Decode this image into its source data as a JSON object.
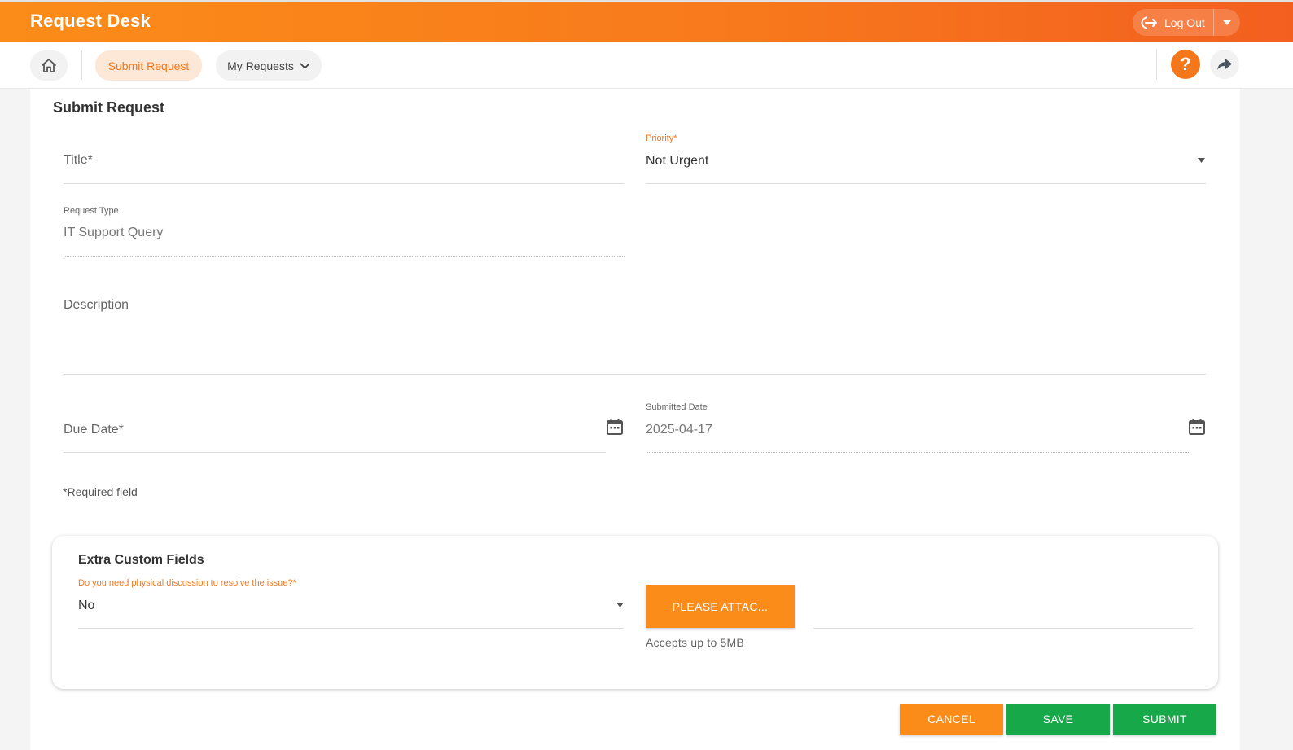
{
  "app": {
    "title": "Request Desk"
  },
  "header": {
    "logout_label": "Log Out"
  },
  "nav": {
    "submit_request": "Submit Request",
    "my_requests": "My Requests",
    "help_glyph": "?"
  },
  "form": {
    "page_title": "Submit Request",
    "title_field": {
      "placeholder": "Title",
      "required_mark": "*"
    },
    "priority": {
      "label": "Priority",
      "required_mark": "*",
      "value": "Not Urgent"
    },
    "request_type": {
      "label": "Request Type",
      "value": "IT Support Query"
    },
    "description": {
      "placeholder": "Description"
    },
    "due_date": {
      "placeholder": "Due Date",
      "required_mark": "*"
    },
    "submitted_date": {
      "label": "Submitted Date",
      "value": "2025-04-17"
    },
    "required_note_mark": "*",
    "required_note": "Required field"
  },
  "extra": {
    "title": "Extra Custom Fields",
    "question_label": "Do you need physical discussion to resolve the issue?",
    "question_required_mark": "*",
    "question_value": "No",
    "attach_label": "PLEASE ATTAC...",
    "accepts_note": "Accepts up to 5MB"
  },
  "actions": {
    "cancel": "CANCEL",
    "save": "SAVE",
    "submit": "SUBMIT"
  },
  "icons": {
    "logout": "logout-icon",
    "caret": "chevron-down-icon",
    "home": "home-icon",
    "help": "help-icon",
    "share": "share-icon",
    "calendar": "calendar-icon"
  },
  "colors": {
    "accent": "#f5771b",
    "success": "#17a84a"
  }
}
